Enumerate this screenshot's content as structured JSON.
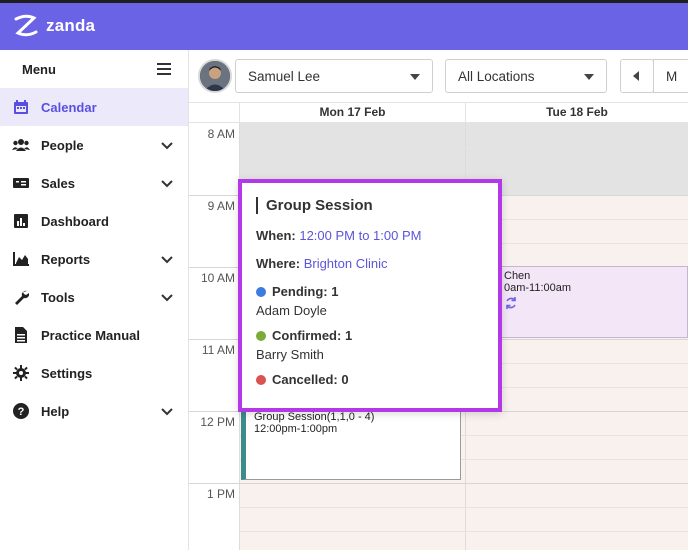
{
  "app": {
    "brand": "zanda"
  },
  "sidebar": {
    "menu_label": "Menu",
    "items": [
      {
        "label": "Calendar",
        "icon": "calendar-icon",
        "active": true,
        "has_chevron": false
      },
      {
        "label": "People",
        "icon": "people-icon",
        "active": false,
        "has_chevron": true
      },
      {
        "label": "Sales",
        "icon": "sales-icon",
        "active": false,
        "has_chevron": true
      },
      {
        "label": "Dashboard",
        "icon": "dashboard-icon",
        "active": false,
        "has_chevron": false
      },
      {
        "label": "Reports",
        "icon": "reports-icon",
        "active": false,
        "has_chevron": true
      },
      {
        "label": "Tools",
        "icon": "wrench-icon",
        "active": false,
        "has_chevron": true
      },
      {
        "label": "Practice Manual",
        "icon": "document-icon",
        "active": false,
        "has_chevron": false
      },
      {
        "label": "Settings",
        "icon": "gear-icon",
        "active": false,
        "has_chevron": false
      },
      {
        "label": "Help",
        "icon": "help-icon",
        "active": false,
        "has_chevron": true
      }
    ]
  },
  "toolbar": {
    "practitioner": "Samuel Lee",
    "location": "All Locations",
    "next_view_partial": "M"
  },
  "calendar": {
    "days": [
      "Mon 17 Feb",
      "Tue 18 Feb"
    ],
    "times": [
      "8 AM",
      "9 AM",
      "10 AM",
      "11 AM",
      "12 PM",
      "1 PM"
    ],
    "event_group": {
      "title": "Group Session(1,1,0 - 4)",
      "time": "12:00pm-1:00pm"
    },
    "event_chen": {
      "title": "Chen",
      "time": "0am-11:00am"
    }
  },
  "popup": {
    "title": "Group Session",
    "when_label": "When:",
    "when_value": "12:00 PM to 1:00 PM",
    "where_label": "Where:",
    "where_value": "Brighton Clinic",
    "pending_label": "Pending: 1",
    "pending_person": "Adam Doyle",
    "confirmed_label": "Confirmed: 1",
    "confirmed_person": "Barry Smith",
    "cancelled_label": "Cancelled: 0"
  },
  "colors": {
    "brand": "#6a63e6",
    "popup_border": "#b338e8",
    "pending": "#3d7be0",
    "confirmed": "#7cab3b",
    "cancelled": "#d9534f"
  }
}
